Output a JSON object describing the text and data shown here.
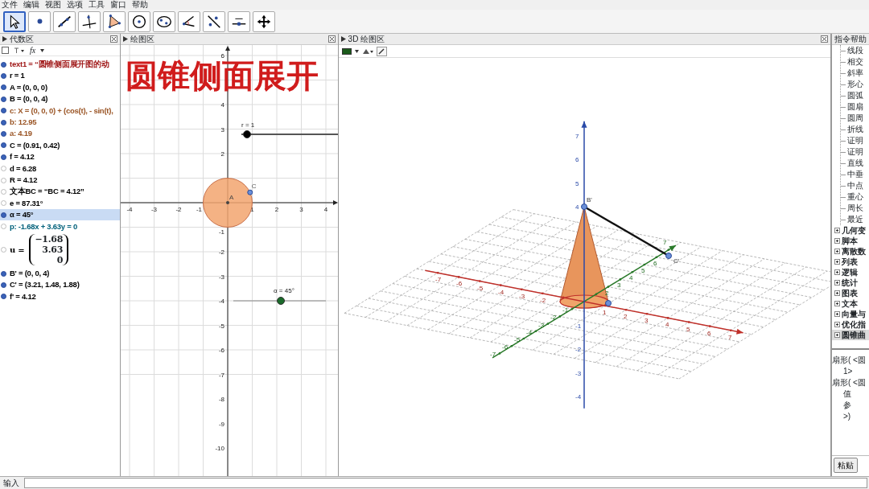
{
  "menu": [
    "文件",
    "编辑",
    "视图",
    "选项",
    "工具",
    "窗口",
    "帮助"
  ],
  "toolbar": [
    {
      "kind": "move",
      "selected": true
    },
    {
      "kind": "point",
      "selected": false
    },
    {
      "kind": "line",
      "selected": false
    },
    {
      "kind": "perpendicular",
      "selected": false
    },
    {
      "kind": "polygon",
      "selected": false
    },
    {
      "kind": "circle",
      "selected": false
    },
    {
      "kind": "conic",
      "selected": false
    },
    {
      "kind": "angle",
      "selected": false
    },
    {
      "kind": "reflect",
      "selected": false
    },
    {
      "kind": "slider",
      "selected": false
    },
    {
      "kind": "move-view",
      "selected": false
    }
  ],
  "algebra": {
    "title": "代数区",
    "function_button": "fx",
    "items": [
      {
        "kind": "text",
        "text": "text1 = “圆锥侧面展开图的动",
        "shown": true,
        "selected": false,
        "color": "#a01818"
      },
      {
        "kind": "text",
        "text": "r = 1",
        "shown": true,
        "selected": false,
        "color": "#000000"
      },
      {
        "kind": "text",
        "text": "A = (0, 0, 0)",
        "shown": true,
        "selected": false,
        "color": "#000000"
      },
      {
        "kind": "text",
        "text": "B = (0, 0, 4)",
        "shown": true,
        "selected": false,
        "color": "#000000"
      },
      {
        "kind": "text",
        "text": "c: X = (0, 0, 0) + (cos(t), - sin(t),",
        "shown": true,
        "selected": false,
        "color": "#9a5424"
      },
      {
        "kind": "text",
        "text": "b: 12.95",
        "shown": true,
        "selected": false,
        "color": "#9a5424"
      },
      {
        "kind": "text",
        "text": "a: 4.19",
        "shown": true,
        "selected": false,
        "color": "#9a5424"
      },
      {
        "kind": "text",
        "text": "C = (0.91, 0.42)",
        "shown": true,
        "selected": false,
        "color": "#000000"
      },
      {
        "kind": "text",
        "text": "f = 4.12",
        "shown": true,
        "selected": false,
        "color": "#000000"
      },
      {
        "kind": "text",
        "text": "d = 6.28",
        "shown": false,
        "selected": false,
        "color": "#000000"
      },
      {
        "kind": "text",
        "text": "R = 4.12",
        "shown": false,
        "selected": false,
        "color": "#000000"
      },
      {
        "kind": "text",
        "text": "文本BC = “BC = 4.12”",
        "shown": false,
        "selected": false,
        "color": "#000000"
      },
      {
        "kind": "text",
        "text": "e = 87.31°",
        "shown": false,
        "selected": false,
        "color": "#000000"
      },
      {
        "kind": "text",
        "text": "α = 45°",
        "shown": true,
        "selected": true,
        "color": "#000000"
      },
      {
        "kind": "text",
        "text": "p: -1.68x + 3.63y = 0",
        "shown": false,
        "selected": false,
        "color": "#00607a"
      },
      {
        "kind": "vector",
        "label": "u =",
        "entries": [
          "−1.68",
          "3.63",
          "0"
        ],
        "shown": false,
        "selected": false,
        "color": "#000000"
      },
      {
        "kind": "text",
        "text": "B' = (0, 0, 4)",
        "shown": true,
        "selected": false,
        "color": "#000000"
      },
      {
        "kind": "text",
        "text": "C' = (3.21, 1.48, 1.88)",
        "shown": true,
        "selected": false,
        "color": "#000000"
      },
      {
        "kind": "text",
        "text": "f' = 4.12",
        "shown": true,
        "selected": false,
        "color": "#000000"
      }
    ]
  },
  "graphics": {
    "title": "绘图区",
    "heading_text": "圆锥侧面展开",
    "x_ticks": [
      "-4",
      "-3",
      "-2",
      "-1",
      "1",
      "2",
      "3",
      "4"
    ],
    "y_ticks": [
      "6",
      "4",
      "3",
      "2",
      "-1",
      "-2",
      "-3",
      "-4",
      "-5",
      "-6",
      "-7",
      "-8",
      "-9",
      "-10"
    ],
    "points": [
      {
        "label": "A"
      },
      {
        "label": "C"
      }
    ],
    "sliders": [
      {
        "label": "r = 1"
      },
      {
        "label": "α = 45°"
      }
    ]
  },
  "graphics3d": {
    "title": "3D 绘图区",
    "x_ticks": [
      "-7",
      "-6",
      "-5",
      "-4",
      "-3",
      "-2",
      "1",
      "2",
      "3",
      "4",
      "5",
      "6",
      "7"
    ],
    "y_ticks": [
      "-7",
      "-6",
      "-5",
      "-4",
      "-3",
      "-2",
      "-1",
      "2",
      "3",
      "4",
      "5",
      "6",
      "7"
    ],
    "z_ticks": [
      "7",
      "6",
      "5",
      "4",
      "-1",
      "-2",
      "-3",
      "-4"
    ],
    "point_labels": [
      "B'",
      "C'"
    ]
  },
  "help": {
    "title": "指令帮助",
    "commands": [
      "线段",
      "相交",
      "斜率",
      "形心",
      "圆弧",
      "圆扇",
      "圆周",
      "折线",
      "证明",
      "证明",
      "直线",
      "中垂",
      "中点",
      "重心",
      "周长",
      "最近"
    ],
    "groups": [
      {
        "label": "几何变",
        "selected": false
      },
      {
        "label": "脚本",
        "selected": false
      },
      {
        "label": "离散数",
        "selected": false
      },
      {
        "label": "列表",
        "selected": false
      },
      {
        "label": "逻辑",
        "selected": false
      },
      {
        "label": "统计",
        "selected": false
      },
      {
        "label": "图表",
        "selected": false
      },
      {
        "label": "文本",
        "selected": false
      },
      {
        "label": "向量与",
        "selected": false
      },
      {
        "label": "优化指",
        "selected": false
      },
      {
        "label": "圆锥曲",
        "selected": true
      }
    ],
    "syntax": [
      {
        "text": "扇形( <圆",
        "indented": false
      },
      {
        "text": "1>",
        "indented": true
      },
      {
        "text": "扇形( <圆",
        "indented": false
      },
      {
        "text": "值",
        "indented": true
      },
      {
        "text": "参",
        "indented": true
      },
      {
        "text": ">)",
        "indented": true
      }
    ],
    "paste_button": "粘贴"
  },
  "input": {
    "label": "输入"
  }
}
